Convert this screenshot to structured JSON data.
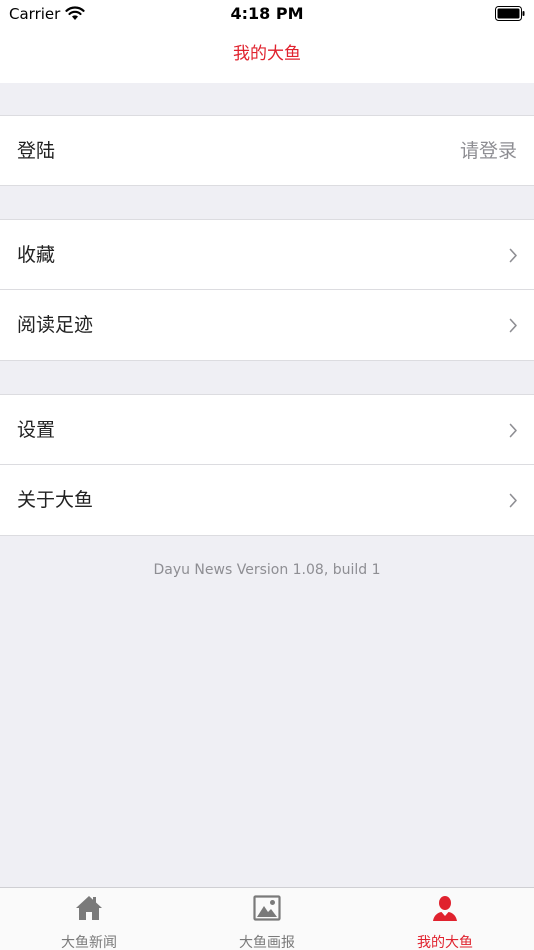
{
  "status_bar": {
    "carrier": "Carrier",
    "time": "4:18 PM"
  },
  "nav": {
    "title": "我的大鱼"
  },
  "sections": {
    "login": {
      "label": "登陆",
      "detail": "请登录"
    },
    "favorites": {
      "label": "收藏"
    },
    "history": {
      "label": "阅读足迹"
    },
    "settings": {
      "label": "设置"
    },
    "about": {
      "label": "关于大鱼"
    }
  },
  "footer": {
    "version_text": "Dayu News Version 1.08, build 1"
  },
  "tab_bar": {
    "tabs": [
      {
        "label": "大鱼新闻",
        "icon": "home-icon",
        "active": false
      },
      {
        "label": "大鱼画报",
        "icon": "picture-icon",
        "active": false
      },
      {
        "label": "我的大鱼",
        "icon": "person-icon",
        "active": true
      }
    ]
  },
  "colors": {
    "accent": "#e0222e",
    "background": "#efeff4",
    "tab_inactive": "#7a7a7a"
  }
}
